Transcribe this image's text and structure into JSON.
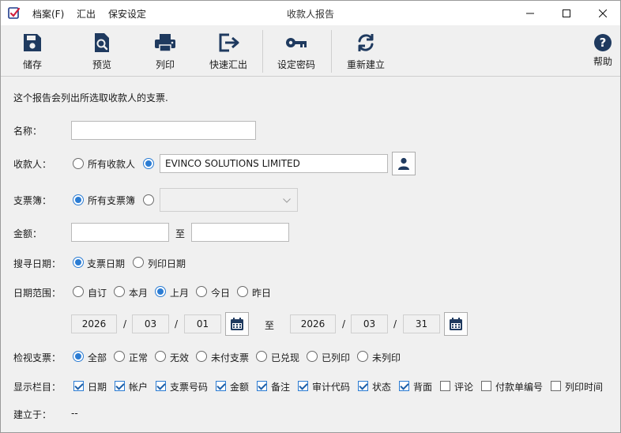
{
  "window": {
    "title": "收款人报告",
    "menu": [
      "档案(F)",
      "汇出",
      "保安设定"
    ]
  },
  "toolbar": {
    "save": "储存",
    "preview": "预览",
    "print": "列印",
    "quick_export": "快速汇出",
    "set_password": "设定密码",
    "rebuild": "重新建立",
    "help": "帮助"
  },
  "form": {
    "description": "这个报告会列出所选取收款人的支票.",
    "name_label": "名称：",
    "name_value": "",
    "payee_label": "收款人：",
    "payee_all": "所有收款人",
    "payee_value": "EVINCO SOLUTIONS LIMITED",
    "chequebook_label": "支票簿：",
    "chequebook_all": "所有支票簿",
    "amount_label": "金额：",
    "amount_to": "至",
    "search_date_label": "搜寻日期：",
    "search_date_options": [
      "支票日期",
      "列印日期"
    ],
    "date_range_label": "日期范围：",
    "date_range_options": [
      "自订",
      "本月",
      "上月",
      "今日",
      "昨日"
    ],
    "date_from": {
      "year": "2026",
      "month": "03",
      "day": "01"
    },
    "date_to_label": "至",
    "date_to": {
      "year": "2026",
      "month": "03",
      "day": "31"
    },
    "date_sep": "/",
    "view_label": "检视支票：",
    "view_options": [
      "全部",
      "正常",
      "无效",
      "未付支票",
      "已兑现",
      "已列印",
      "未列印"
    ],
    "columns_label": "显示栏目：",
    "columns": [
      {
        "label": "日期",
        "checked": true
      },
      {
        "label": "帐户",
        "checked": true
      },
      {
        "label": "支票号码",
        "checked": true
      },
      {
        "label": "金额",
        "checked": true
      },
      {
        "label": "备注",
        "checked": true
      },
      {
        "label": "审计代码",
        "checked": true
      },
      {
        "label": "状态",
        "checked": true
      },
      {
        "label": "背面",
        "checked": true
      },
      {
        "label": "评论",
        "checked": false
      },
      {
        "label": "付款单编号",
        "checked": false
      },
      {
        "label": "列印时间",
        "checked": false
      }
    ],
    "created_label": "建立于：",
    "created_value": "--"
  },
  "colors": {
    "accent": "#2b7cd3",
    "icon": "#1f3a5f"
  }
}
